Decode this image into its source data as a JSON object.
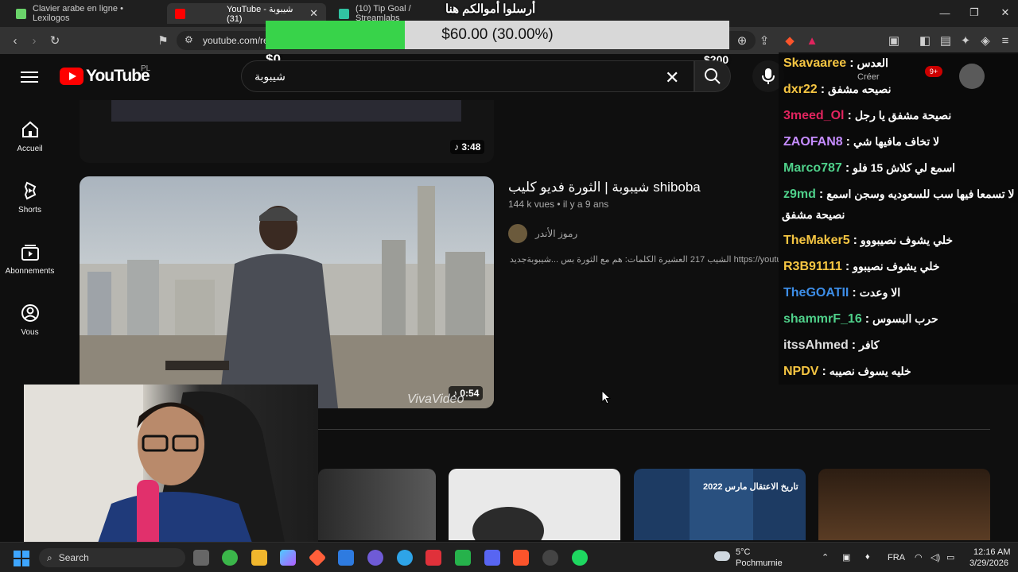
{
  "browser": {
    "tabs": [
      {
        "title": "Clavier arabe en ligne • Lexilogos",
        "active": false,
        "favicon": "lexilogos-icon"
      },
      {
        "title": "YouTube - شيبوبة (31)",
        "active": true,
        "favicon": "youtube-icon"
      },
      {
        "title": "(10) Tip Goal / Streamlabs",
        "active": false,
        "favicon": "streamlabs-icon"
      }
    ],
    "url": "youtube.com/re"
  },
  "goal": {
    "title": "أرسلوا أموالكم هنا",
    "text": "$60.00 (30.00%)",
    "progress_fraction": 0.3,
    "min_label": "$0",
    "max_label": "$200"
  },
  "youtube": {
    "logo_text": "YouTube",
    "country": "PL",
    "search_value": "شيبوبة",
    "guide": [
      {
        "label": "Accueil",
        "icon": "home-icon"
      },
      {
        "label": "Shorts",
        "icon": "shorts-icon"
      },
      {
        "label": "Abonnements",
        "icon": "subscriptions-icon"
      },
      {
        "label": "Vous",
        "icon": "account-icon"
      }
    ],
    "notif_count": "9+",
    "create_label": "Créer",
    "prev_video_duration": "3:48",
    "video": {
      "title": "شيبوبة | الثورة فديو كليب shiboba",
      "views": "144 k vues",
      "age": "il y a 9 ans",
      "channel": "رموز الأندر",
      "description": "الشيب 217 العشيرة الكلمات: هم مع الثورة بس ...شيبوبةجديد https://youtu.be/",
      "duration": "0:54",
      "watermark": "VivaVideo"
    },
    "shelf_title": "تاريخ الاعتقال مارس 2022"
  },
  "chat": [
    {
      "user": "Skavaaree",
      "color": "#f5c542",
      "message": "العدس"
    },
    {
      "user": "dxr22",
      "color": "#f5c542",
      "message": "نصيحه مشفق"
    },
    {
      "user": "3meed_Ol",
      "color": "#e0245e",
      "message": "نصيحة مشفق يا رجل"
    },
    {
      "user": "ZAOFAN8",
      "color": "#c58cff",
      "message": "لا تخاف مافيها شي"
    },
    {
      "user": "Marco787",
      "color": "#4fd08a",
      "message": "اسمع لي كلاش 15 فلو"
    },
    {
      "user": "z9md",
      "color": "#4fd08a",
      "message": "لا تسمعا فيها سب للسعوديه وسجن اسمع"
    },
    {
      "user": "TheMaker5",
      "color": "#f5c542",
      "message": "خلي يشوف نصيبووو"
    },
    {
      "user": "R3B91111",
      "color": "#f5c542",
      "message": "خلي يشوف نصيبوو"
    },
    {
      "user": "TheGOATII",
      "color": "#3d8ee8",
      "message": "الا وعدت"
    },
    {
      "user": "shammrF_16",
      "color": "#4fd08a",
      "message": "حرب البسوس"
    },
    {
      "user": "itssAhmed",
      "color": "#dddddd",
      "message": "كافر"
    },
    {
      "user": "NPDV",
      "color": "#f5c542",
      "message": "خليه يسوف نصيبه"
    }
  ],
  "chat_continuation": "نصيحة مشفق",
  "taskbar": {
    "search_placeholder": "Search",
    "weather_temp": "5°C",
    "weather_place": "Pochmurnie",
    "lang": "FRA",
    "time": "12:16 AM",
    "date": "3/29/2026"
  }
}
